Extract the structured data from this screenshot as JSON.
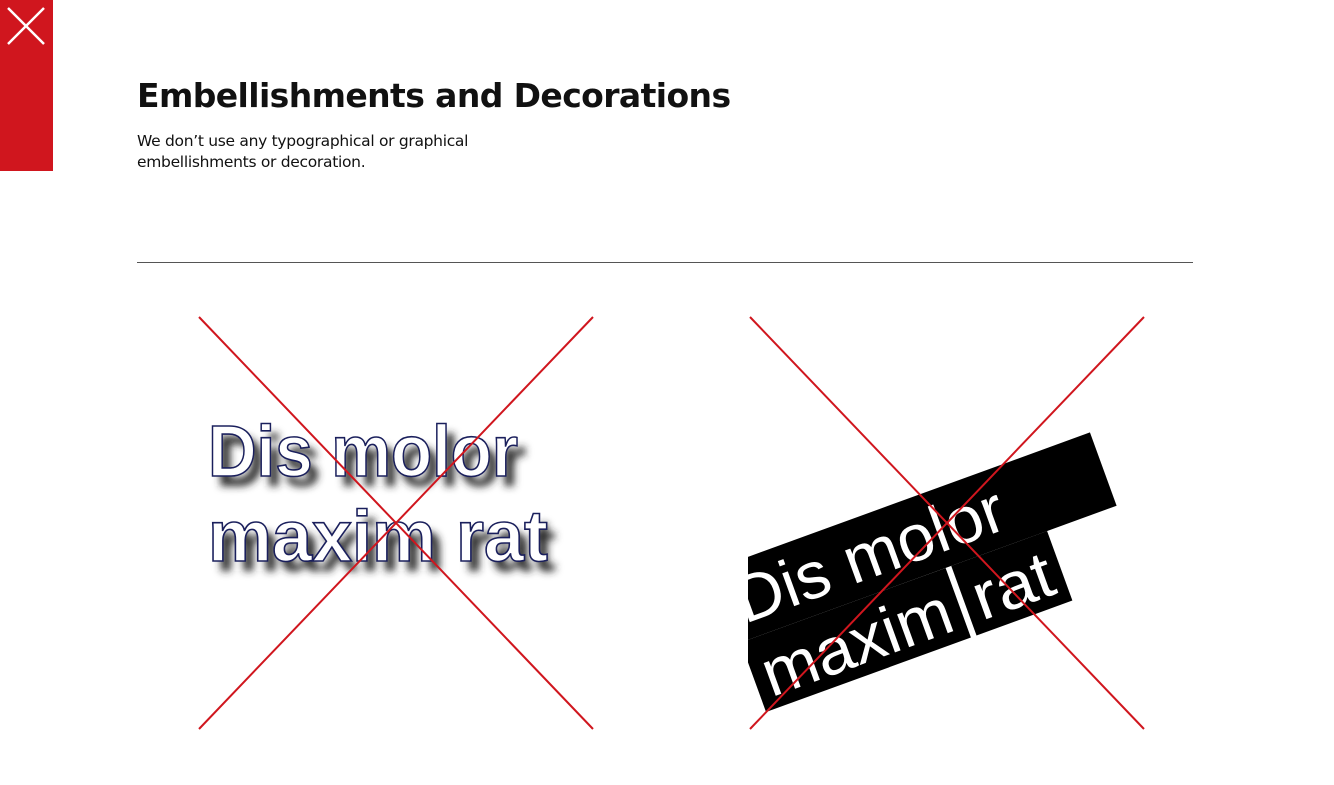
{
  "page": {
    "title": "Embellishments and Decorations",
    "intro": "We don’t use any typographical or graphical embellishments or decoration."
  },
  "close_tab": {
    "icon": "close-icon",
    "color": "#d0161e"
  },
  "examples": [
    {
      "kind": "drop-shadow-outline-text",
      "line1": "Dis molor",
      "line2": "maxim rat",
      "strike_icon": "cross-out-icon",
      "strike_color": "#d0161e"
    },
    {
      "kind": "rotated-boxed-text",
      "line1": "Dis molor",
      "line2a": "maxim",
      "line2b": "rat",
      "strike_icon": "cross-out-icon",
      "strike_color": "#d0161e"
    }
  ]
}
